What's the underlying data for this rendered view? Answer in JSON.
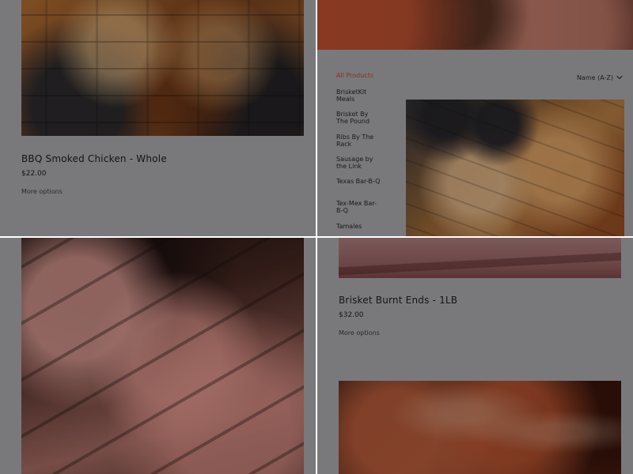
{
  "panels": {
    "top_left": {
      "product": {
        "title": "BBQ Smoked Chicken - Whole",
        "price": "$22.00",
        "more_options": "More options"
      }
    },
    "top_right": {
      "sidebar": {
        "items": [
          {
            "label": "All Products",
            "active": true
          },
          {
            "label": "BrisketKit Meals",
            "active": false
          },
          {
            "label": "Brisket By The Pound",
            "active": false
          },
          {
            "label": "Ribs By The Rack",
            "active": false
          },
          {
            "label": "Sausage by the Link",
            "active": false
          },
          {
            "label": "Texas Bar-B-Q",
            "active": false
          },
          {
            "label": "Tex-Mex Bar-B-Q",
            "active": false
          },
          {
            "label": "Tamales",
            "active": false
          }
        ]
      },
      "sort": {
        "label": "Name (A-Z)",
        "icon": "chevron-down-icon"
      }
    },
    "bottom_right": {
      "product": {
        "title": "Brisket Burnt Ends - 1LB",
        "price": "$32.00",
        "more_options": "More options"
      }
    }
  },
  "colors": {
    "accent": "#d1512b",
    "background": "#bdbdc2",
    "overlay": "rgba(0,0,0,0.36)"
  }
}
